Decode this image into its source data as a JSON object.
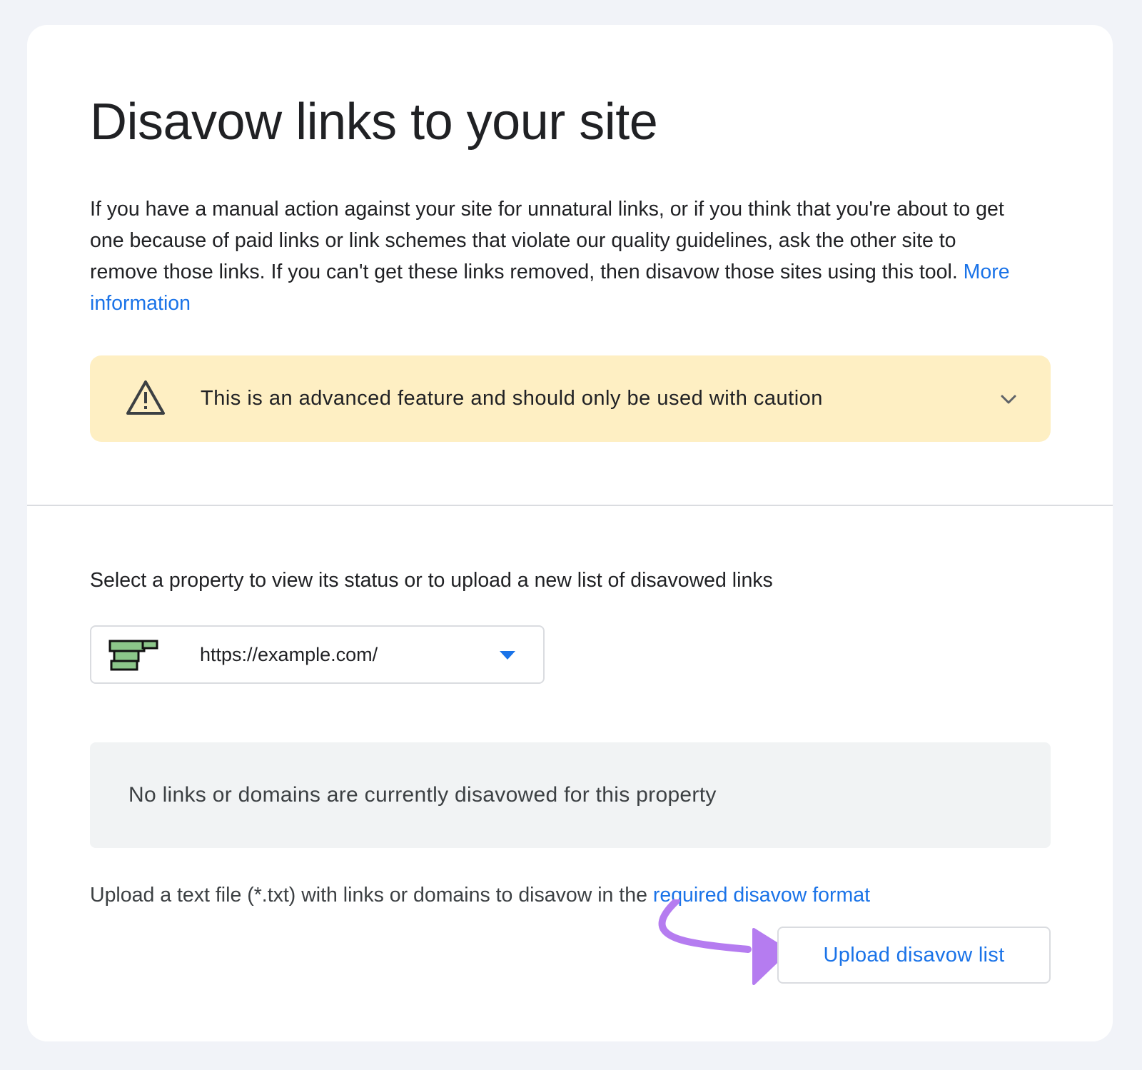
{
  "page": {
    "title": "Disavow links to your site",
    "description": "If you have a manual action against your site for unnatural links, or if you think that you're about to get one because of paid links or link schemes that violate our quality guidelines, ask the other site to remove those links. If you can't get these links removed, then disavow those sites using this tool.",
    "more_info_link": "More information"
  },
  "warning": {
    "icon": "warning-triangle-icon",
    "text": "This is an advanced feature and should only be used with caution",
    "expand_icon": "chevron-down-icon"
  },
  "property": {
    "label": "Select a property to view its status or to upload a new list of disavowed links",
    "selected": "https://example.com/",
    "icon": "site-favicon-icon",
    "dropdown_icon": "dropdown-arrow-icon"
  },
  "status": {
    "text": "No links or domains are currently disavowed for this property"
  },
  "upload": {
    "info_text": "Upload a text file (*.txt) with links or domains to disavow in the",
    "format_link": "required disavow format",
    "button_label": "Upload disavow list"
  },
  "colors": {
    "link_blue": "#1a73e8",
    "warning_bg": "#feefc3",
    "annotation_purple": "#b57cf0",
    "page_bg": "#f1f3f8"
  }
}
